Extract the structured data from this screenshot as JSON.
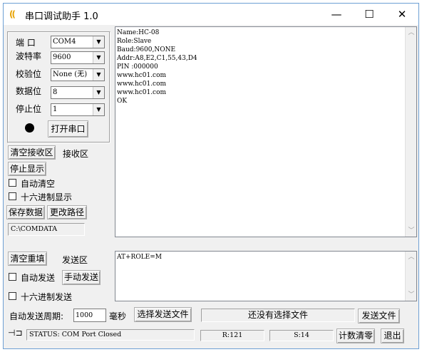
{
  "titlebar": {
    "title": "串口调试助手 1.0",
    "icon": "kk-app-icon",
    "minimize_glyph": "—",
    "maximize_glyph": "☐",
    "close_glyph": "✕"
  },
  "serial_config": {
    "port_label": "端  口",
    "port_value": "COM4",
    "baud_label": "波特率",
    "baud_value": "9600",
    "parity_label": "校验位",
    "parity_value": "None (无)",
    "databits_label": "数据位",
    "databits_value": "8",
    "stopbits_label": "停止位",
    "stopbits_value": "1",
    "open_port_label": "打开串口"
  },
  "receive_panel": {
    "clear_label": "清空接收区",
    "area_label": "接收区",
    "stop_display_label": "停止显示",
    "auto_clear_label": "自动清空",
    "hex_display_label": "十六进制显示",
    "save_data_label": "保存数据",
    "change_path_label": "更改路径",
    "path_value": "C:\\COMDATA",
    "lines": [
      "Name:HC-08",
      "Role:Slave",
      "Baud:9600,NONE",
      "Addr:A8,E2,C1,55,43,D4",
      "PIN :000000",
      "www.hc01.com",
      "www.hc01.com",
      "www.hc01.com",
      "OK"
    ]
  },
  "send_panel": {
    "clear_reset_label": "清空重填",
    "area_label": "发送区",
    "auto_send_label": "自动发送",
    "manual_send_label": "手动发送",
    "hex_send_label": "十六进制发送",
    "send_text": "AT+ROLE=M",
    "period_label": "自动发送周期:",
    "period_value": "1000",
    "period_unit": "毫秒",
    "select_file_label": "选择发送文件",
    "file_status": "还没有选择文件",
    "send_file_label": "发送文件"
  },
  "statusbar": {
    "status_text": "STATUS: COM Port Closed",
    "rx_count": "R:121",
    "tx_count": "S:14",
    "reset_count_label": "计数清零",
    "exit_label": "退出"
  }
}
